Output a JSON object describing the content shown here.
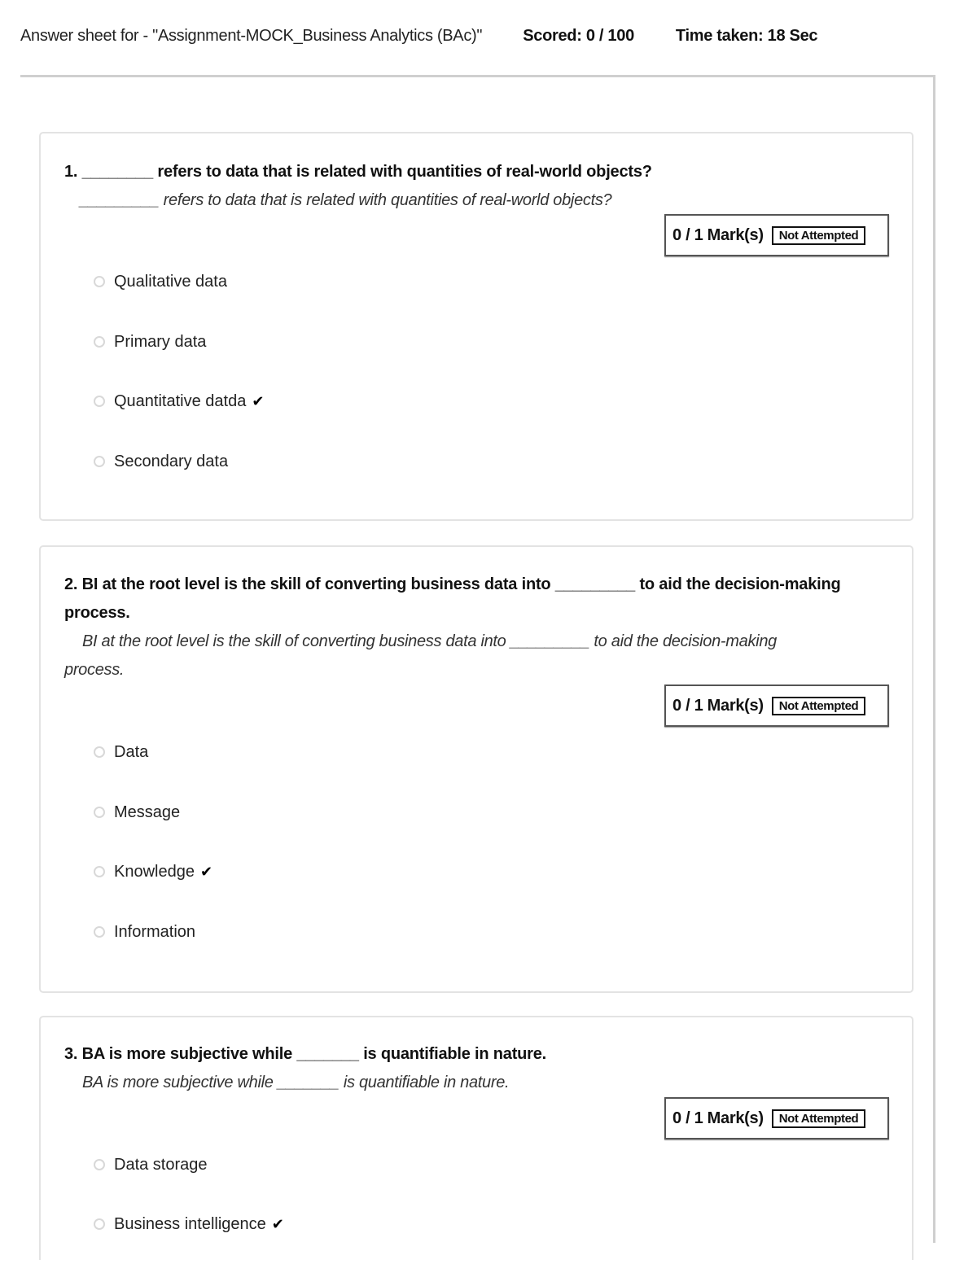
{
  "header": {
    "title": "Answer sheet for - \"Assignment-MOCK_Business Analytics (BAc)\"",
    "score": "Scored: 0 / 100",
    "time_taken": "Time taken: 18 Sec"
  },
  "questions": [
    {
      "text": "1. ________ refers to data that is related with quantities of real-world objects?",
      "subtext": "_________ refers to data that is related with quantities of real-world objects?",
      "marks": "0 / 1 Mark(s)",
      "status": "Not Attempted",
      "options": [
        {
          "label": "Qualitative data",
          "correct": false
        },
        {
          "label": "Primary data",
          "correct": false
        },
        {
          "label": "Quantitative datda",
          "correct": true
        },
        {
          "label": "Secondary data",
          "correct": false
        }
      ]
    },
    {
      "text": "2. BI at the root level is the skill of converting business data into _________ to aid the decision-making process.",
      "subtext": "BI at the root level is the skill of converting business data into _________ to aid the decision-making process.",
      "marks": "0 / 1 Mark(s)",
      "status": "Not Attempted",
      "options": [
        {
          "label": "Data",
          "correct": false
        },
        {
          "label": "Message",
          "correct": false
        },
        {
          "label": "Knowledge",
          "correct": true
        },
        {
          "label": "Information",
          "correct": false
        }
      ]
    },
    {
      "text": "3. BA is more subjective while _______ is quantifiable in nature.",
      "subtext": "BA is more subjective while _______ is quantifiable in nature.",
      "marks": "0 / 1 Mark(s)",
      "status": "Not Attempted",
      "options": [
        {
          "label": "Data storage",
          "correct": false
        },
        {
          "label": "Business intelligence",
          "correct": true
        }
      ]
    }
  ],
  "icons": {
    "correct": "✔"
  }
}
